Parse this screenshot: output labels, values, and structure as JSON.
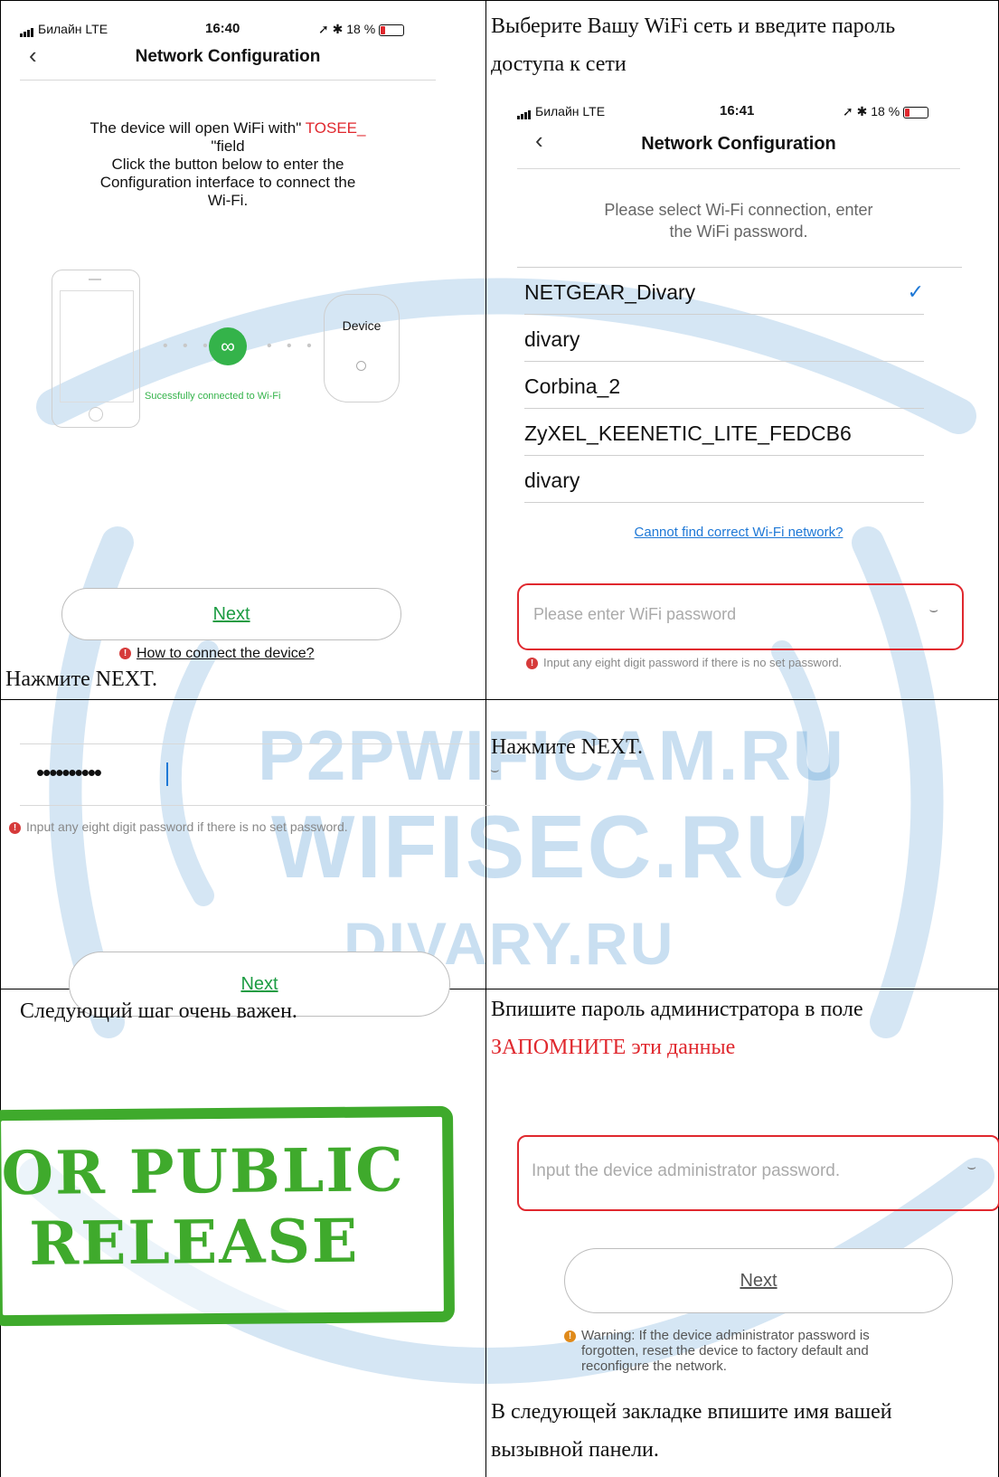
{
  "cell1": {
    "status": {
      "carrier": "Билайн  LTE",
      "time": "16:40",
      "battery": "18 %"
    },
    "nav_title": "Network Configuration",
    "message_pre": "The device will open WiFi with\" ",
    "message_highlight": "TOSEE_",
    "message_line2": "\"field",
    "message_line3": "Click the button below to enter the",
    "message_line4": "Configuration interface to connect the",
    "message_line5": "Wi-Fi.",
    "device_label": "Device",
    "connected_text": "Sucessfully connected to Wi-Fi",
    "next_label": "Next",
    "help_link": "How to connect the device?",
    "caption": "Нажмите NEXT."
  },
  "cell2": {
    "intro_line1": "Выберите Вашу WiFi сеть и введите пароль",
    "intro_line2": "доступа к сети",
    "status": {
      "carrier": "Билайн  LTE",
      "time": "16:41",
      "battery": "18 %"
    },
    "nav_title": "Network Configuration",
    "prompt_line1": "Please select Wi-Fi connection, enter",
    "prompt_line2": "the WiFi password.",
    "networks": [
      "NETGEAR_Divary",
      "divary",
      "Corbina_2",
      "ZyXEL_KEENETIC_LITE_FEDCB6",
      "divary"
    ],
    "selected_index": 0,
    "cannot_find_link": "Cannot find correct Wi-Fi network?",
    "password_placeholder": "Please enter WiFi password",
    "password_hint": "Input any eight digit password if there is no set password.",
    "highlight_color": "#e0282e"
  },
  "cell3": {
    "password_masked": "••••••••••",
    "password_hint": "Input any eight digit password if there is no set password.",
    "next_label": "Next"
  },
  "cell4": {
    "caption": "Нажмите NEXT."
  },
  "cell5": {
    "caption": "Следующий шаг очень важен.",
    "stamp_line1": "OR PUBLIC",
    "stamp_line2": "RELEASE",
    "stamp_color": "#3faa2c"
  },
  "cell6": {
    "caption_line1": "Впишите пароль администратора в поле",
    "caption_line2": "ЗАПОМНИТЕ эти данные",
    "admin_placeholder": "Input the device administrator password.",
    "next_label": "Next",
    "warning_line1": "Warning: If the device administrator password is",
    "warning_line2": "forgotten, reset the device to factory default and",
    "warning_line3": "reconfigure the network.",
    "footer_line1": "В следующей закладке впишите имя вашей",
    "footer_line2": "вызывной панели."
  },
  "watermark": {
    "line1": "P2PWIFICAM.RU",
    "line2": "WIFISEC.RU",
    "line3": "DIVARY.RU",
    "color": "#3f8fcf"
  }
}
